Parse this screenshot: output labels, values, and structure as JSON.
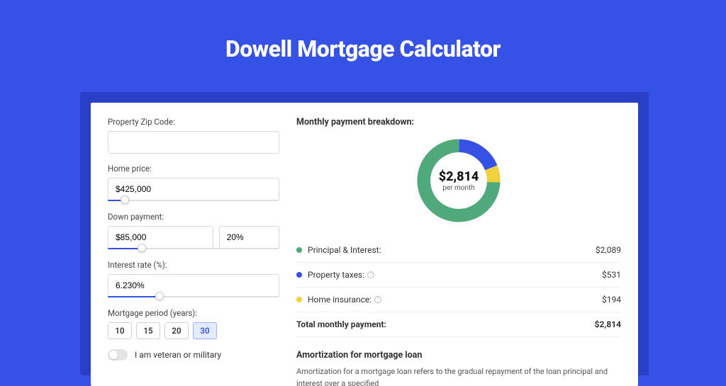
{
  "page": {
    "title": "Dowell Mortgage Calculator"
  },
  "form": {
    "zip": {
      "label": "Property Zip Code:",
      "value": ""
    },
    "home_price": {
      "label": "Home price:",
      "value": "$425,000",
      "slider_pct": 10
    },
    "down_payment": {
      "label": "Down payment:",
      "amount": "$85,000",
      "pct": "20%",
      "slider_pct": 20
    },
    "interest": {
      "label": "Interest rate (%):",
      "value": "6.230%",
      "slider_pct": 30
    },
    "period": {
      "label": "Mortgage period (years):",
      "options": [
        "10",
        "15",
        "20",
        "30"
      ],
      "selected": "30"
    },
    "veteran": {
      "label": "I am veteran or military",
      "checked": false
    }
  },
  "breakdown": {
    "heading": "Monthly payment breakdown:",
    "donut_center_amount": "$2,814",
    "donut_center_sub": "per month",
    "items": [
      {
        "label": "Principal & Interest:",
        "value": "$2,089",
        "color": "#4fa97a",
        "info": false
      },
      {
        "label": "Property taxes:",
        "value": "$531",
        "color": "#3651e6",
        "info": true
      },
      {
        "label": "Home insurance:",
        "value": "$194",
        "color": "#f1d23c",
        "info": true
      }
    ],
    "total": {
      "label": "Total monthly payment:",
      "value": "$2,814"
    }
  },
  "amort": {
    "title": "Amortization for mortgage loan",
    "text": "Amortization for a mortgage loan refers to the gradual repayment of the loan principal and interest over a specified"
  },
  "chart_data": {
    "type": "pie",
    "title": "Monthly payment breakdown",
    "categories": [
      "Principal & Interest",
      "Property taxes",
      "Home insurance"
    ],
    "values": [
      2089,
      531,
      194
    ],
    "colors": [
      "#4fa97a",
      "#3651e6",
      "#f1d23c"
    ],
    "total": 2814,
    "center_label": "$2,814 per month"
  }
}
